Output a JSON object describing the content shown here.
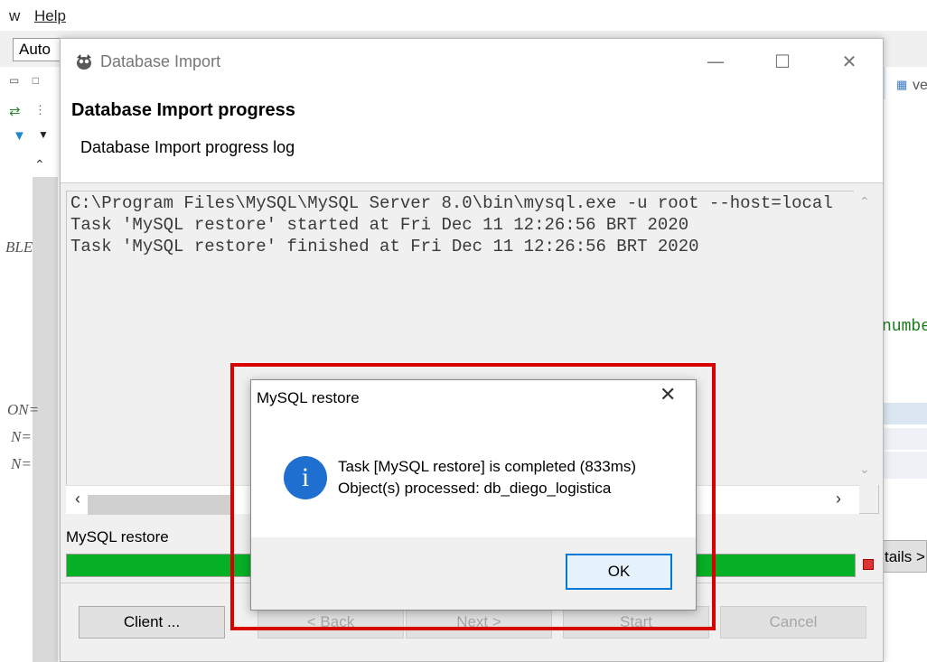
{
  "menubar": {
    "items": [
      "w",
      "Help"
    ]
  },
  "toolbar": {
    "combo_value": "Auto"
  },
  "background": {
    "left_labels": [
      "BLE",
      "ON=",
      "N=",
      "N="
    ],
    "right_labels": [
      "ve",
      "numbe",
      "tails >"
    ]
  },
  "dialog": {
    "title": "Database Import",
    "header_title": "Database Import progress",
    "header_subtitle": "Database Import progress log",
    "log_lines": [
      "C:\\Program Files\\MySQL\\MySQL Server 8.0\\bin\\mysql.exe -u root --host=local",
      "Task 'MySQL restore' started at Fri Dec 11 12:26:56 BRT 2020",
      "Task 'MySQL restore' finished at Fri Dec 11 12:26:56 BRT 2020"
    ],
    "task_label": "MySQL restore",
    "progress_fraction": 1.0,
    "buttons": {
      "client": "Client ...",
      "back": "< Back",
      "next": "Next >",
      "start": "Start",
      "cancel": "Cancel"
    }
  },
  "message_box": {
    "title": "MySQL restore",
    "line1": "Task [MySQL restore] is completed (833ms)",
    "line2": "Object(s) processed: db_diego_logistica",
    "ok_label": "OK",
    "icon": "info-icon"
  },
  "colors": {
    "progress": "#06b025",
    "highlight": "#d90000",
    "info_icon": "#1f6fd1",
    "ok_border": "#0078d7"
  }
}
